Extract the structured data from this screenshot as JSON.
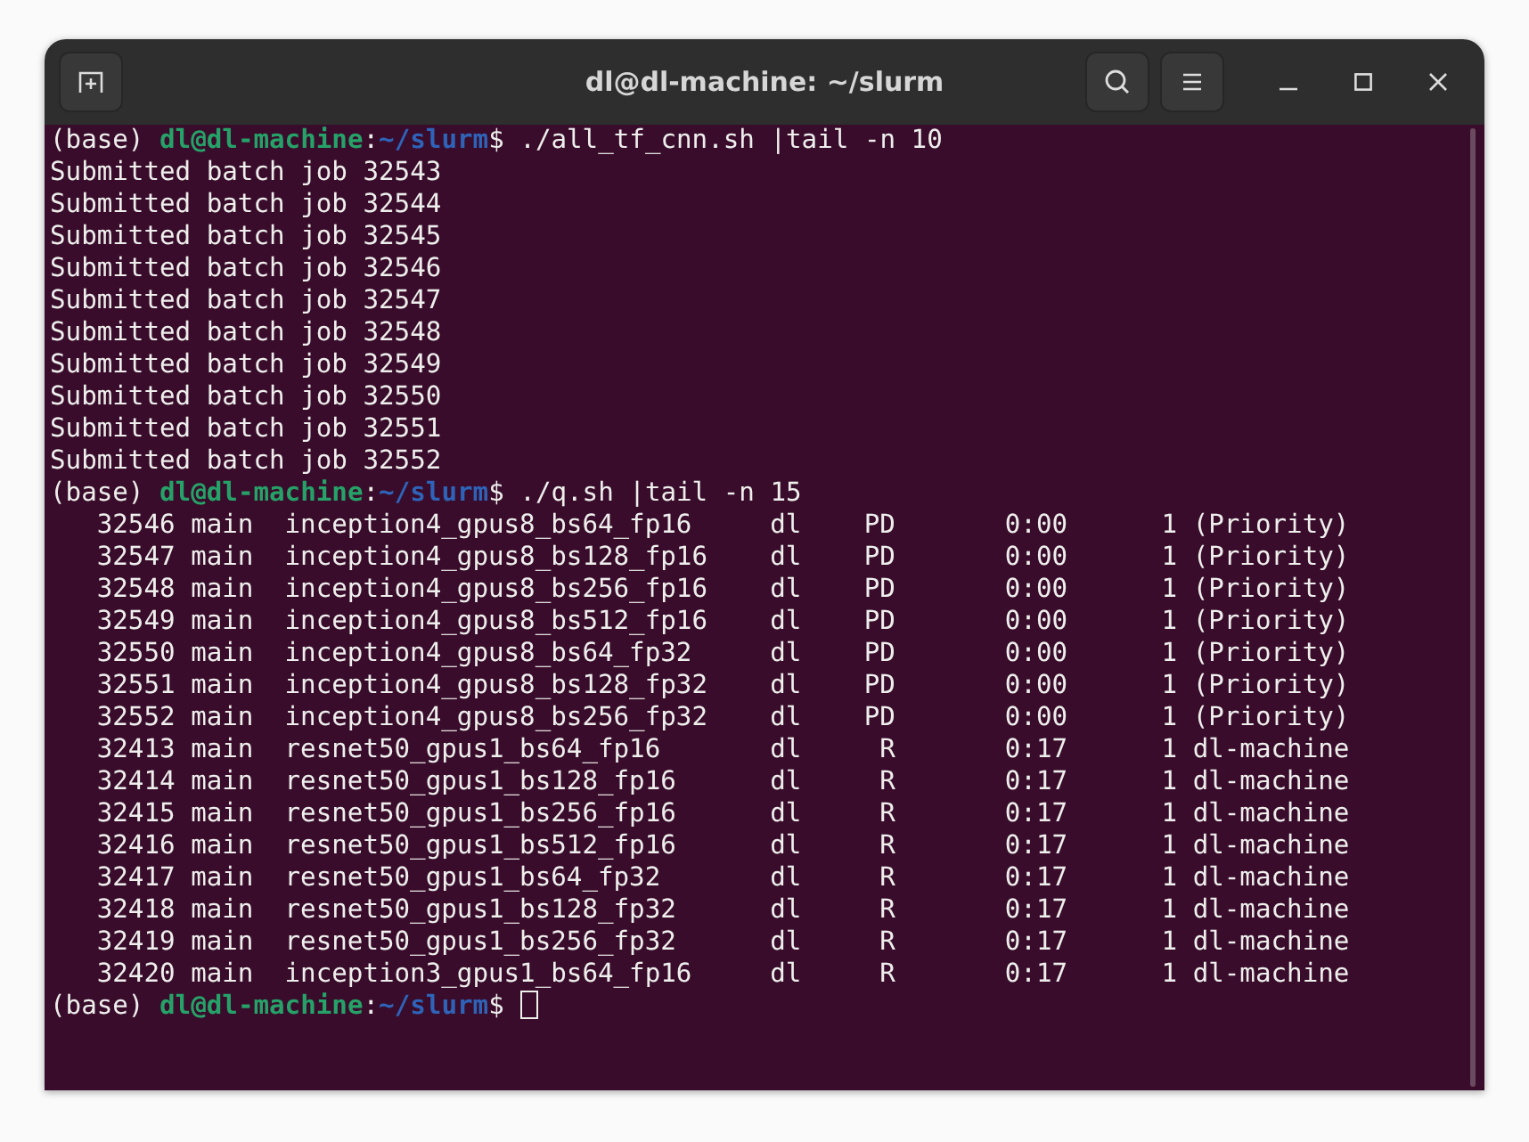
{
  "window": {
    "title": "dl@dl-machine: ~/slurm"
  },
  "lines": [
    {
      "kind": "prompt",
      "env": "(base)",
      "user": "dl@dl-machine",
      "sep": ":",
      "path": "~/slurm",
      "symbol": "$",
      "command": "./all_tf_cnn.sh |tail -n 10"
    },
    {
      "kind": "output",
      "text": "Submitted batch job 32543"
    },
    {
      "kind": "output",
      "text": "Submitted batch job 32544"
    },
    {
      "kind": "output",
      "text": "Submitted batch job 32545"
    },
    {
      "kind": "output",
      "text": "Submitted batch job 32546"
    },
    {
      "kind": "output",
      "text": "Submitted batch job 32547"
    },
    {
      "kind": "output",
      "text": "Submitted batch job 32548"
    },
    {
      "kind": "output",
      "text": "Submitted batch job 32549"
    },
    {
      "kind": "output",
      "text": "Submitted batch job 32550"
    },
    {
      "kind": "output",
      "text": "Submitted batch job 32551"
    },
    {
      "kind": "output",
      "text": "Submitted batch job 32552"
    },
    {
      "kind": "prompt",
      "env": "(base)",
      "user": "dl@dl-machine",
      "sep": ":",
      "path": "~/slurm",
      "symbol": "$",
      "command": "./q.sh |tail -n 15"
    },
    {
      "kind": "job",
      "cells": [
        "32546",
        "main",
        "inception4_gpus8_bs64_fp16",
        "dl",
        "PD",
        "0:00",
        "1",
        "(Priority)"
      ]
    },
    {
      "kind": "job",
      "cells": [
        "32547",
        "main",
        "inception4_gpus8_bs128_fp16",
        "dl",
        "PD",
        "0:00",
        "1",
        "(Priority)"
      ]
    },
    {
      "kind": "job",
      "cells": [
        "32548",
        "main",
        "inception4_gpus8_bs256_fp16",
        "dl",
        "PD",
        "0:00",
        "1",
        "(Priority)"
      ]
    },
    {
      "kind": "job",
      "cells": [
        "32549",
        "main",
        "inception4_gpus8_bs512_fp16",
        "dl",
        "PD",
        "0:00",
        "1",
        "(Priority)"
      ]
    },
    {
      "kind": "job",
      "cells": [
        "32550",
        "main",
        "inception4_gpus8_bs64_fp32",
        "dl",
        "PD",
        "0:00",
        "1",
        "(Priority)"
      ]
    },
    {
      "kind": "job",
      "cells": [
        "32551",
        "main",
        "inception4_gpus8_bs128_fp32",
        "dl",
        "PD",
        "0:00",
        "1",
        "(Priority)"
      ]
    },
    {
      "kind": "job",
      "cells": [
        "32552",
        "main",
        "inception4_gpus8_bs256_fp32",
        "dl",
        "PD",
        "0:00",
        "1",
        "(Priority)"
      ]
    },
    {
      "kind": "job",
      "cells": [
        "32413",
        "main",
        "resnet50_gpus1_bs64_fp16",
        "dl",
        "R",
        "0:17",
        "1",
        "dl-machine"
      ]
    },
    {
      "kind": "job",
      "cells": [
        "32414",
        "main",
        "resnet50_gpus1_bs128_fp16",
        "dl",
        "R",
        "0:17",
        "1",
        "dl-machine"
      ]
    },
    {
      "kind": "job",
      "cells": [
        "32415",
        "main",
        "resnet50_gpus1_bs256_fp16",
        "dl",
        "R",
        "0:17",
        "1",
        "dl-machine"
      ]
    },
    {
      "kind": "job",
      "cells": [
        "32416",
        "main",
        "resnet50_gpus1_bs512_fp16",
        "dl",
        "R",
        "0:17",
        "1",
        "dl-machine"
      ]
    },
    {
      "kind": "job",
      "cells": [
        "32417",
        "main",
        "resnet50_gpus1_bs64_fp32",
        "dl",
        "R",
        "0:17",
        "1",
        "dl-machine"
      ]
    },
    {
      "kind": "job",
      "cells": [
        "32418",
        "main",
        "resnet50_gpus1_bs128_fp32",
        "dl",
        "R",
        "0:17",
        "1",
        "dl-machine"
      ]
    },
    {
      "kind": "job",
      "cells": [
        "32419",
        "main",
        "resnet50_gpus1_bs256_fp32",
        "dl",
        "R",
        "0:17",
        "1",
        "dl-machine"
      ]
    },
    {
      "kind": "job",
      "cells": [
        "32420",
        "main",
        "inception3_gpus1_bs64_fp16",
        "dl",
        "R",
        "0:17",
        "1",
        "dl-machine"
      ]
    },
    {
      "kind": "prompt",
      "env": "(base)",
      "user": "dl@dl-machine",
      "sep": ":",
      "path": "~/slurm",
      "symbol": "$",
      "cursor": true
    }
  ]
}
